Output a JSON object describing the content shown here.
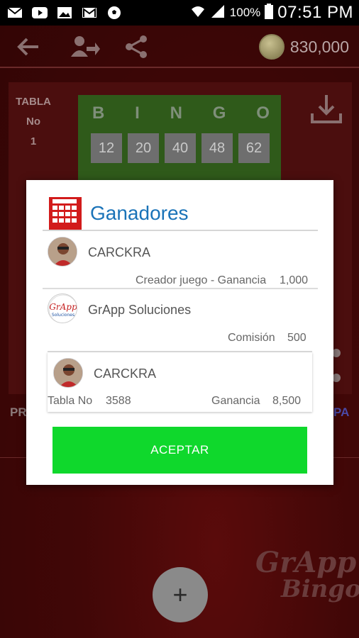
{
  "status_bar": {
    "icons": [
      "mail-icon",
      "youtube-icon",
      "image-icon",
      "gmail-icon",
      "soccer-ball-icon",
      "wifi-icon",
      "signal-icon",
      "battery-icon"
    ],
    "battery": "100%",
    "time": "07:51 PM"
  },
  "toolbar": {
    "coins": "830,000"
  },
  "background": {
    "tabla_label": "TABLA",
    "no_label": "No",
    "no_value": "1",
    "bingo_letters": [
      "B",
      "I",
      "N",
      "G",
      "O"
    ],
    "bingo_numbers": [
      "12",
      "20",
      "40",
      "48",
      "62"
    ],
    "left_partial": "PR",
    "right_partial": "PA",
    "fab_label": "+",
    "brand_line1": "GrApp",
    "brand_line2": "Bingo"
  },
  "dialog": {
    "title": "Ganadores",
    "entries": [
      {
        "name": "CARCKRA",
        "detail_label": "Creador juego - Ganancia",
        "detail_value": "1,000"
      },
      {
        "name": "GrApp Soluciones",
        "detail_label": "Comisión",
        "detail_value": "500"
      }
    ],
    "winner": {
      "name": "CARCKRA",
      "tabla_label": "Tabla No",
      "tabla_value": "3588",
      "ganancia_label": "Ganancia",
      "ganancia_value": "8,500"
    },
    "accept_label": "ACEPTAR"
  },
  "colors": {
    "title_blue": "#1a73b8",
    "accept_green": "#0fd82c",
    "brand_red": "#d21b1b"
  }
}
